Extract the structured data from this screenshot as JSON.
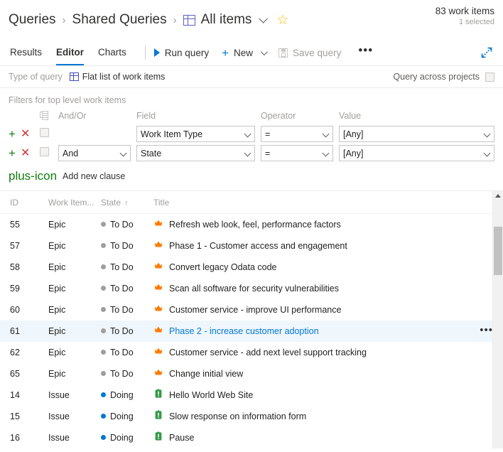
{
  "header": {
    "breadcrumb": [
      {
        "label": "Queries",
        "icon": null
      },
      {
        "label": "Shared Queries",
        "icon": null
      },
      {
        "label": "All items",
        "icon": "grid-table-icon"
      }
    ],
    "separator": "›",
    "favorite_icon": "star-icon",
    "dropdown_icon": "chevron-down-icon",
    "work_items_count": "83 work items",
    "selected_count": "1 selected"
  },
  "toolbar": {
    "tabs": [
      {
        "label": "Results",
        "active": false
      },
      {
        "label": "Editor",
        "active": true
      },
      {
        "label": "Charts",
        "active": false
      }
    ],
    "run_query_label": "Run query",
    "run_query_icon": "play-icon",
    "new_label": "New",
    "new_icon": "plus-icon",
    "save_query_label": "Save query",
    "save_query_icon": "save-disk-icon",
    "save_query_disabled": true,
    "overflow_label": "•••",
    "expand_icon": "expand-diagonal-icon"
  },
  "query_type": {
    "label": "Type of query",
    "value": "Flat list of work items",
    "value_icon": "grid-table-icon",
    "across_projects_label": "Query across projects",
    "across_projects_checked": false
  },
  "filters": {
    "section_title": "Filters for top level work items",
    "columns": {
      "group": "group-icon",
      "andor": "And/Or",
      "field": "Field",
      "operator": "Operator",
      "value": "Value"
    },
    "rows": [
      {
        "add_icon": "+",
        "remove_icon": "✕",
        "checked": false,
        "andor": "",
        "field": "Work Item Type",
        "operator": "=",
        "value": "[Any]"
      },
      {
        "add_icon": "+",
        "remove_icon": "✕",
        "checked": false,
        "andor": "And",
        "field": "State",
        "operator": "=",
        "value": "[Any]"
      }
    ],
    "add_clause_label": "Add new clause",
    "add_clause_icon": "plus-icon"
  },
  "results": {
    "columns": [
      {
        "label": "ID",
        "sorted": false
      },
      {
        "label": "Work Item...",
        "sorted": false
      },
      {
        "label": "State",
        "sorted": true,
        "sort_icon": "↑"
      },
      {
        "label": "Title",
        "sorted": false
      }
    ],
    "rows": [
      {
        "id": "55",
        "type": "Epic",
        "state": "To Do",
        "state_color": "#9e9e9e",
        "title": "Refresh web look, feel, performance factors",
        "icon": "epic-crown-icon",
        "icon_color": "#ff7b00",
        "selected": false
      },
      {
        "id": "57",
        "type": "Epic",
        "state": "To Do",
        "state_color": "#9e9e9e",
        "title": "Phase 1 - Customer access and engagement",
        "icon": "epic-crown-icon",
        "icon_color": "#ff7b00",
        "selected": false
      },
      {
        "id": "58",
        "type": "Epic",
        "state": "To Do",
        "state_color": "#9e9e9e",
        "title": "Convert legacy Odata code",
        "icon": "epic-crown-icon",
        "icon_color": "#ff7b00",
        "selected": false
      },
      {
        "id": "59",
        "type": "Epic",
        "state": "To Do",
        "state_color": "#9e9e9e",
        "title": "Scan all software for security vulnerabilities",
        "icon": "epic-crown-icon",
        "icon_color": "#ff7b00",
        "selected": false
      },
      {
        "id": "60",
        "type": "Epic",
        "state": "To Do",
        "state_color": "#9e9e9e",
        "title": "Customer service - improve UI performance",
        "icon": "epic-crown-icon",
        "icon_color": "#ff7b00",
        "selected": false
      },
      {
        "id": "61",
        "type": "Epic",
        "state": "To Do",
        "state_color": "#9e9e9e",
        "title": "Phase 2 - increase customer adoption",
        "icon": "epic-crown-icon",
        "icon_color": "#ff7b00",
        "selected": true,
        "row_menu": "•••"
      },
      {
        "id": "62",
        "type": "Epic",
        "state": "To Do",
        "state_color": "#9e9e9e",
        "title": "Customer service - add next level support tracking",
        "icon": "epic-crown-icon",
        "icon_color": "#ff7b00",
        "selected": false
      },
      {
        "id": "65",
        "type": "Epic",
        "state": "To Do",
        "state_color": "#9e9e9e",
        "title": "Change initial view",
        "icon": "epic-crown-icon",
        "icon_color": "#ff7b00",
        "selected": false
      },
      {
        "id": "14",
        "type": "Issue",
        "state": "Doing",
        "state_color": "#0078d4",
        "title": "Hello World Web Site",
        "icon": "issue-icon",
        "icon_color": "#339947",
        "selected": false
      },
      {
        "id": "15",
        "type": "Issue",
        "state": "Doing",
        "state_color": "#0078d4",
        "title": "Slow response on information form",
        "icon": "issue-icon",
        "icon_color": "#339947",
        "selected": false
      },
      {
        "id": "16",
        "type": "Issue",
        "state": "Doing",
        "state_color": "#0078d4",
        "title": "Pause",
        "icon": "issue-icon",
        "icon_color": "#339947",
        "selected": false
      }
    ],
    "scrollbar": {
      "up_arrow_icon": "caret-up-icon"
    }
  },
  "colors": {
    "accent": "#0078d4",
    "selected_row_bg": "#eff6fc",
    "epic_orange": "#ff7b00",
    "issue_green": "#339947",
    "add_green": "#107c10",
    "remove_red": "#d13438",
    "star_gold": "#ffb900"
  }
}
